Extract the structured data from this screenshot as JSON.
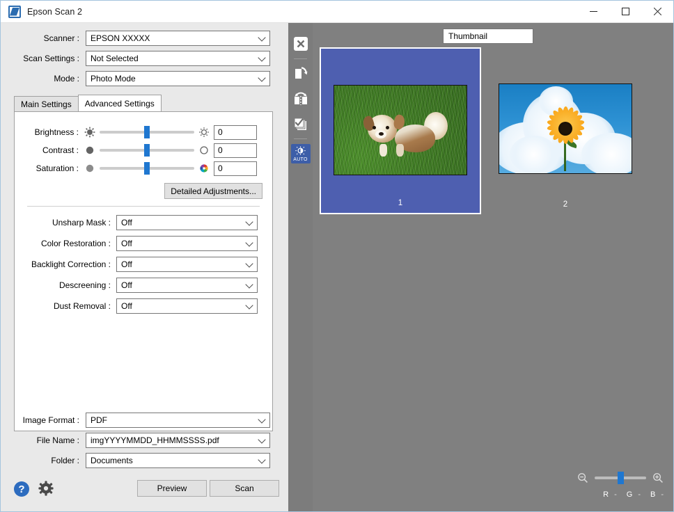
{
  "window": {
    "title": "Epson Scan 2",
    "app_icon": "scanner-icon",
    "minimize_label": "–",
    "maximize_label": "☐",
    "close_label": "✕"
  },
  "top_fields": [
    {
      "label": "Scanner :",
      "value": "EPSON XXXXX",
      "name": "scanner"
    },
    {
      "label": "Scan Settings :",
      "value": "Not Selected",
      "name": "scan-settings"
    },
    {
      "label": "Mode :",
      "value": "Photo Mode",
      "name": "mode"
    }
  ],
  "tabs": [
    {
      "label": "Main Settings",
      "active": false
    },
    {
      "label": "Advanced Settings",
      "active": true
    }
  ],
  "sliders": [
    {
      "label": "Brightness :",
      "value": "0",
      "left_icon": "sun-filled-icon",
      "right_icon": "sun-outline-icon"
    },
    {
      "label": "Contrast :",
      "value": "0",
      "left_icon": "circle-filled-icon",
      "right_icon": "circle-outline-icon"
    },
    {
      "label": "Saturation :",
      "value": "0",
      "left_icon": "circle-gray-icon",
      "right_icon": "color-wheel-icon"
    }
  ],
  "detailed_adjustments_label": "Detailed Adjustments...",
  "dropdowns": [
    {
      "label": "Unsharp Mask :",
      "value": "Off"
    },
    {
      "label": "Color Restoration :",
      "value": "Off"
    },
    {
      "label": "Backlight Correction :",
      "value": "Off"
    },
    {
      "label": "Descreening :",
      "value": "Off"
    },
    {
      "label": "Dust Removal :",
      "value": "Off"
    }
  ],
  "bottom_fields": [
    {
      "label": "Image Format :",
      "value": "PDF",
      "name": "image-format"
    },
    {
      "label": "File Name :",
      "value": "imgYYYYMMDD_HHMMSSSS.pdf",
      "name": "file-name"
    },
    {
      "label": "Folder :",
      "value": "Documents",
      "name": "folder"
    }
  ],
  "actions": {
    "help_label": "?",
    "settings_icon": "gear-icon",
    "preview_label": "Preview",
    "scan_label": "Scan"
  },
  "preview": {
    "view_mode": "Thumbnail",
    "toolbar": [
      {
        "name": "clear-preview-icon",
        "label": "close-x-icon"
      },
      {
        "name": "rotate-right-icon",
        "label": "rotate-icon"
      },
      {
        "name": "flip-horizontal-icon",
        "label": "flip-icon"
      },
      {
        "name": "select-all-pages-icon",
        "label": "checkstack-icon"
      },
      {
        "name": "auto-exposure-icon",
        "label": "AUTO"
      }
    ],
    "auto_badge_text": "AUTO",
    "thumbnails": [
      {
        "number": "1",
        "selected": true,
        "subject": "puppy-on-grass-photo"
      },
      {
        "number": "2",
        "selected": false,
        "subject": "sunflower-in-sky-photo"
      }
    ],
    "zoom": {
      "out_icon": "zoom-out-icon",
      "in_icon": "zoom-in-icon"
    },
    "channels": [
      {
        "label": "R",
        "value": "-"
      },
      {
        "label": "G",
        "value": "-"
      },
      {
        "label": "B",
        "value": "-"
      }
    ]
  },
  "colors": {
    "accent": "#1f77d0",
    "selection": "#4e5fb0",
    "preview_bg": "#808080",
    "toolbar_bg": "#7c7c7c",
    "auto_active": "#3d5ea8",
    "pane_bg": "#e9e9e9"
  }
}
